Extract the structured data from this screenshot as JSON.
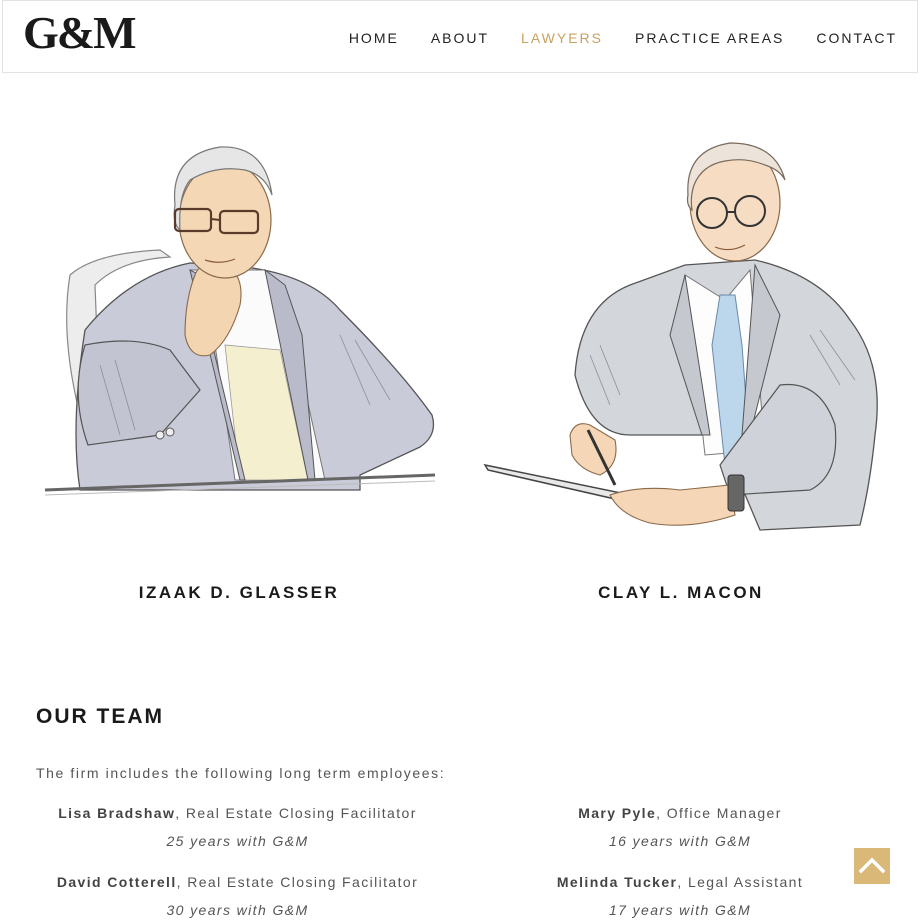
{
  "brand": {
    "logo_text": "G&M"
  },
  "nav": {
    "items": [
      {
        "label": "HOME",
        "active": false
      },
      {
        "label": "ABOUT",
        "active": false
      },
      {
        "label": "LAWYERS",
        "active": true
      },
      {
        "label": "PRACTICE AREAS",
        "active": false
      },
      {
        "label": "CONTACT",
        "active": false
      }
    ]
  },
  "lawyers": [
    {
      "name": "IZAAK D. GLASSER"
    },
    {
      "name": "CLAY L. MACON"
    }
  ],
  "team": {
    "title": "OUR TEAM",
    "intro": "The firm includes the following long term employees:",
    "members": [
      {
        "name": "Lisa Bradshaw",
        "role": ", Real Estate Closing Facilitator",
        "years": "25 years with G&M"
      },
      {
        "name": "Mary Pyle",
        "role": ", Office Manager",
        "years": "16 years with G&M"
      },
      {
        "name": "David Cotterell",
        "role": ", Real Estate Closing Facilitator",
        "years": "30 years with G&M"
      },
      {
        "name": "Melinda Tucker",
        "role": ", Legal Assistant",
        "years": "17 years with G&M"
      }
    ]
  },
  "colors": {
    "accent": "#c9a160",
    "scroll_button": "#d9b878",
    "text": "#222222"
  },
  "icons": {
    "scroll_top": "chevron-up-icon"
  }
}
